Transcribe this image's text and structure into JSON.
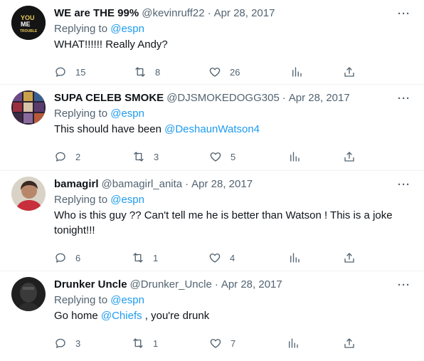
{
  "tweets": [
    {
      "name": "WE are THE 99%",
      "handle": "@kevinruff22",
      "separator": "·",
      "date": "Apr 28, 2017",
      "replying_label": "Replying to",
      "replying_to": "@espn",
      "text_lines": [
        "WHAT!!!!!! Really Andy?"
      ],
      "mention": "",
      "text_after": "",
      "avatar_text": [
        "YOU",
        "ME",
        "TROUBLE"
      ],
      "stats": {
        "replies": "15",
        "retweets": "8",
        "likes": "26"
      }
    },
    {
      "name": "SUPA CELEB SMOKE",
      "handle": "@DJSMOKEDOGG305",
      "separator": "·",
      "date": "Apr 28, 2017",
      "replying_label": "Replying to",
      "replying_to": "@espn",
      "text_before": "This should have been ",
      "mention": "@DeshaunWatson4",
      "text_after": "",
      "stats": {
        "replies": "2",
        "retweets": "3",
        "likes": "5"
      }
    },
    {
      "name": "bamagirl",
      "handle": "@bamagirl_anita",
      "separator": "·",
      "date": "Apr 28, 2017",
      "replying_label": "Replying to",
      "replying_to": "@espn",
      "text_lines": [
        "Who is this guy ?? Can't tell me he is better than Watson ! This is a joke",
        "tonight!!!"
      ],
      "stats": {
        "replies": "6",
        "retweets": "1",
        "likes": "4"
      }
    },
    {
      "name": "Drunker Uncle",
      "handle": "@Drunker_Uncle",
      "separator": "·",
      "date": "Apr 28, 2017",
      "replying_label": "Replying to",
      "replying_to": "@espn",
      "text_before": "Go home ",
      "mention": "@Chiefs",
      "text_after": " , you're drunk",
      "stats": {
        "replies": "3",
        "retweets": "1",
        "likes": "7"
      }
    }
  ],
  "more_glyph": "···",
  "colors": {
    "link": "#1d9bf0",
    "muted": "#536471",
    "text": "#0f1419",
    "divider": "#eff3f4"
  }
}
